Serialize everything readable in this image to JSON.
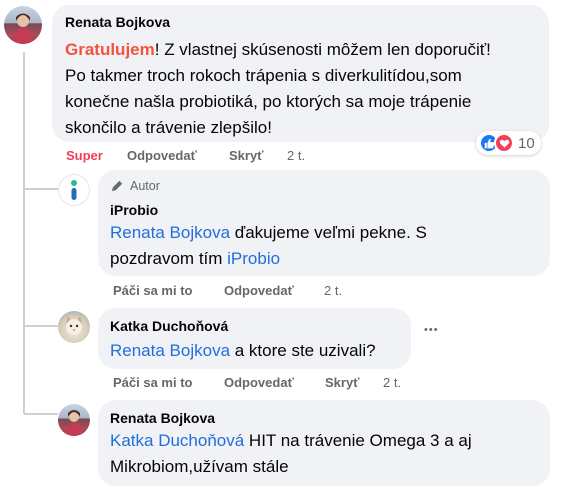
{
  "comments": [
    {
      "author": "Renata Bojkova",
      "text_highlight": "Gratulujem",
      "text_rest": "! Z vlastnej skúsenosti môžem len doporučiť! Po takmer troch rokoch trápenia s diverkulitídou,som konečne našla probiotiká, po ktorých sa moje trápenie skončilo a trávenie zlepšilo!",
      "line1_rest": "! Z vlastnej skúsenosti môžem len doporučiť!",
      "line2": "Po takmer troch rokoch trápenia s diverkulitídou,som",
      "line3": "konečne našla probiotiká, po ktorých sa moje trápenie",
      "line4": "skončilo a trávenie zlepšilo!",
      "reaction_count": "10",
      "actions": {
        "react": "Super",
        "reply": "Odpovedať",
        "hide": "Skryť",
        "time": "2 t."
      }
    },
    {
      "badge": "Autor",
      "author": "iProbio",
      "mention": "Renata Bojkova",
      "line1_rest": " ďakujeme veľmi pekne. S",
      "line2_pre": "pozdravom tím ",
      "line2_mention": "iProbio",
      "actions": {
        "react": "Páči sa mi to",
        "reply": "Odpovedať",
        "time": "2 t."
      }
    },
    {
      "author": "Katka Duchoňová",
      "mention": "Renata Bojkova",
      "text_rest": " a ktore ste uzivali?",
      "more": "•••",
      "actions": {
        "react": "Páči sa mi to",
        "reply": "Odpovedať",
        "hide": "Skryť",
        "time": "2 t."
      }
    },
    {
      "author": "Renata Bojkova",
      "mention": "Katka Duchoňová",
      "line1_rest": " HIT na trávenie Omega 3 a aj",
      "line2": "Mikrobiom,užívam stále"
    }
  ],
  "colors": {
    "bubble": "#f0f2f5",
    "mention": "#216fdb",
    "highlight": "#f5533d",
    "meta": "#65676b",
    "like": "#1877f2",
    "love": "#f33e58"
  }
}
